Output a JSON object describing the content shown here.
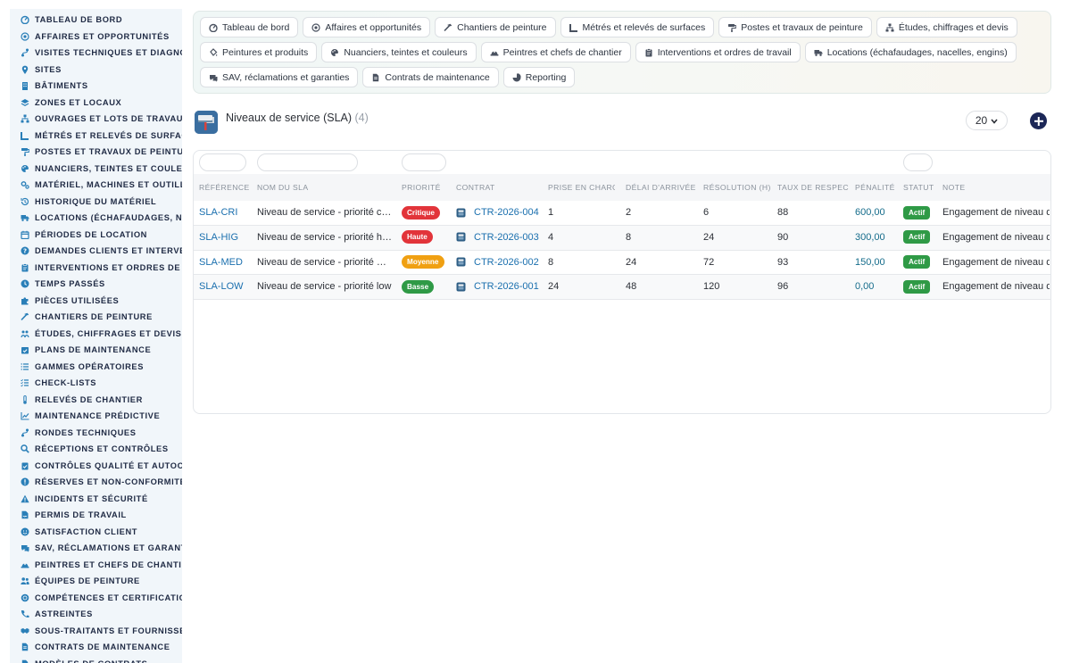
{
  "sidebar": {
    "items": [
      {
        "label": "TABLEAU DE BORD",
        "icon": "gauge-icon"
      },
      {
        "label": "AFFAIRES ET OPPORTUNITÉS",
        "icon": "target-icon"
      },
      {
        "label": "VISITES TECHNIQUES ET DIAGNOSTICS",
        "icon": "route-icon"
      },
      {
        "label": "SITES",
        "icon": "map-pin-icon"
      },
      {
        "label": "BÂTIMENTS",
        "icon": "building-icon"
      },
      {
        "label": "ZONES ET LOCAUX",
        "icon": "layers-icon"
      },
      {
        "label": "OUVRAGES ET LOTS DE TRAVAUX",
        "icon": "sitemap-icon"
      },
      {
        "label": "MÉTRÉS ET RELEVÉS DE SURFACES",
        "icon": "ruler-icon"
      },
      {
        "label": "POSTES ET TRAVAUX DE PEINTURE",
        "icon": "paint-roller-icon"
      },
      {
        "label": "NUANCIERS, TEINTES ET COULEURS",
        "icon": "palette-icon"
      },
      {
        "label": "MATÉRIEL, MACHINES ET OUTILLAGE",
        "icon": "cogs-icon"
      },
      {
        "label": "HISTORIQUE DU MATÉRIEL",
        "icon": "history-icon"
      },
      {
        "label": "LOCATIONS (ÉCHAFAUDAGES, NACELLES, ENGINS)",
        "icon": "truck-icon"
      },
      {
        "label": "PÉRIODES DE LOCATION",
        "icon": "calendar-icon"
      },
      {
        "label": "DEMANDES CLIENTS ET INTERVENTIONS",
        "icon": "question-circle-icon"
      },
      {
        "label": "INTERVENTIONS ET ORDRES DE TRAVAIL",
        "icon": "clipboard-icon"
      },
      {
        "label": "TEMPS PASSÉS",
        "icon": "clock-icon"
      },
      {
        "label": "PIÈCES UTILISÉES",
        "icon": "puzzle-icon"
      },
      {
        "label": "CHANTIERS DE PEINTURE",
        "icon": "hammer-icon"
      },
      {
        "label": "ÉTUDES, CHIFFRAGES ET DEVIS",
        "icon": "calculator-icon"
      },
      {
        "label": "PLANS DE MAINTENANCE",
        "icon": "calendar-check-icon"
      },
      {
        "label": "GAMMES OPÉRATOIRES",
        "icon": "list-icon"
      },
      {
        "label": "CHECK-LISTS",
        "icon": "checklist-icon"
      },
      {
        "label": "RELEVÉS DE CHANTIER",
        "icon": "thermometer-icon"
      },
      {
        "label": "MAINTENANCE PRÉDICTIVE",
        "icon": "chart-line-icon"
      },
      {
        "label": "RONDES TECHNIQUES",
        "icon": "route-icon"
      },
      {
        "label": "RÉCEPTIONS ET CONTRÔLES",
        "icon": "search-icon"
      },
      {
        "label": "CONTRÔLES QUALITÉ ET AUTOCONTRÔLES",
        "icon": "clipboard-check-icon"
      },
      {
        "label": "RÉSERVES ET NON-CONFORMITÉS",
        "icon": "exclamation-circle-icon"
      },
      {
        "label": "INCIDENTS ET SÉCURITÉ",
        "icon": "warning-icon"
      },
      {
        "label": "PERMIS DE TRAVAIL",
        "icon": "file-signature-icon"
      },
      {
        "label": "SATISFACTION CLIENT",
        "icon": "smile-icon"
      },
      {
        "label": "SAV, RÉCLAMATIONS ET GARANTIES",
        "icon": "comments-icon"
      },
      {
        "label": "PEINTRES ET CHEFS DE CHANTIER",
        "icon": "hard-hat-icon"
      },
      {
        "label": "ÉQUIPES DE PEINTURE",
        "icon": "users-icon"
      },
      {
        "label": "COMPÉTENCES ET CERTIFICATIONS",
        "icon": "certificate-icon"
      },
      {
        "label": "ASTREINTES",
        "icon": "phone-icon"
      },
      {
        "label": "SOUS-TRAITANTS ET FOURNISSEURS",
        "icon": "handshake-icon"
      },
      {
        "label": "CONTRATS DE MAINTENANCE",
        "icon": "file-contract-icon"
      },
      {
        "label": "MODÈLES DE CONTRATS",
        "icon": "file-icon"
      }
    ]
  },
  "topnav": {
    "rows": [
      [
        {
          "label": "Tableau de bord",
          "icon": "gauge-icon"
        },
        {
          "label": "Affaires et opportunités",
          "icon": "target-icon"
        },
        {
          "label": "Chantiers de peinture",
          "icon": "hammer-icon"
        },
        {
          "label": "Métrés et relevés de surfaces",
          "icon": "ruler-icon"
        },
        {
          "label": "Postes et travaux de peinture",
          "icon": "paint-roller-icon"
        },
        {
          "label": "Études, chiffrages et devis",
          "icon": "sitemap-icon"
        }
      ],
      [
        {
          "label": "Peintures et produits",
          "icon": "fill-drip-icon"
        },
        {
          "label": "Nuanciers, teintes et couleurs",
          "icon": "palette-icon"
        },
        {
          "label": "Peintres et chefs de chantier",
          "icon": "hard-hat-icon"
        },
        {
          "label": "Interventions et ordres de travail",
          "icon": "clipboard-icon"
        },
        {
          "label": "Locations (échafaudages, nacelles, engins)",
          "icon": "truck-icon"
        }
      ],
      [
        {
          "label": "SAV, réclamations et garanties",
          "icon": "comments-icon"
        },
        {
          "label": "Contrats de maintenance",
          "icon": "file-contract-icon"
        },
        {
          "label": "Reporting",
          "icon": "chart-pie-icon"
        }
      ]
    ]
  },
  "header": {
    "title": "Niveaux de service (SLA)",
    "count": "(4)",
    "icon": "paint-roller-app-icon",
    "page_size": "20",
    "add_icon": "plus-circle-icon"
  },
  "table": {
    "columns": [
      "Référence",
      "Nom du SLA",
      "Priorité",
      "Contrat",
      "Prise en charge (h)",
      "Délai d'arrivée (h)",
      "Résolution (h)",
      "Taux de respect (%)",
      "Pénalité",
      "Statut",
      "Note"
    ],
    "rows": [
      {
        "ref": "SLA-CRI",
        "name": "Niveau de service - priorité critique",
        "priority": "Critique",
        "priority_color": "#e2343a",
        "contract": "CTR-2026-004",
        "takeover": "1",
        "arrival": "2",
        "resolution": "6",
        "rate": "88",
        "penalty": "600,00",
        "status": "Actif",
        "note": "Engagement de niveau de service"
      },
      {
        "ref": "SLA-HIG",
        "name": "Niveau de service - priorité high",
        "priority": "Haute",
        "priority_color": "#e2343a",
        "contract": "CTR-2026-003",
        "takeover": "4",
        "arrival": "8",
        "resolution": "24",
        "rate": "90",
        "penalty": "300,00",
        "status": "Actif",
        "note": "Engagement de niveau de service"
      },
      {
        "ref": "SLA-MED",
        "name": "Niveau de service - priorité medium",
        "priority": "Moyenne",
        "priority_color": "#f0a012",
        "contract": "CTR-2026-002",
        "takeover": "8",
        "arrival": "24",
        "resolution": "72",
        "rate": "93",
        "penalty": "150,00",
        "status": "Actif",
        "note": "Engagement de niveau de service"
      },
      {
        "ref": "SLA-LOW",
        "name": "Niveau de service - priorité low",
        "priority": "Basse",
        "priority_color": "#2f9a46",
        "contract": "CTR-2026-001",
        "takeover": "24",
        "arrival": "48",
        "resolution": "120",
        "rate": "96",
        "penalty": "0,00",
        "status": "Actif",
        "note": "Engagement de niveau de service"
      }
    ]
  },
  "colors": {
    "accent": "#1a6fae",
    "sidebar_bg": "#f1f6fa",
    "add_button": "#1c2757",
    "status_active": "#2f9a46"
  }
}
